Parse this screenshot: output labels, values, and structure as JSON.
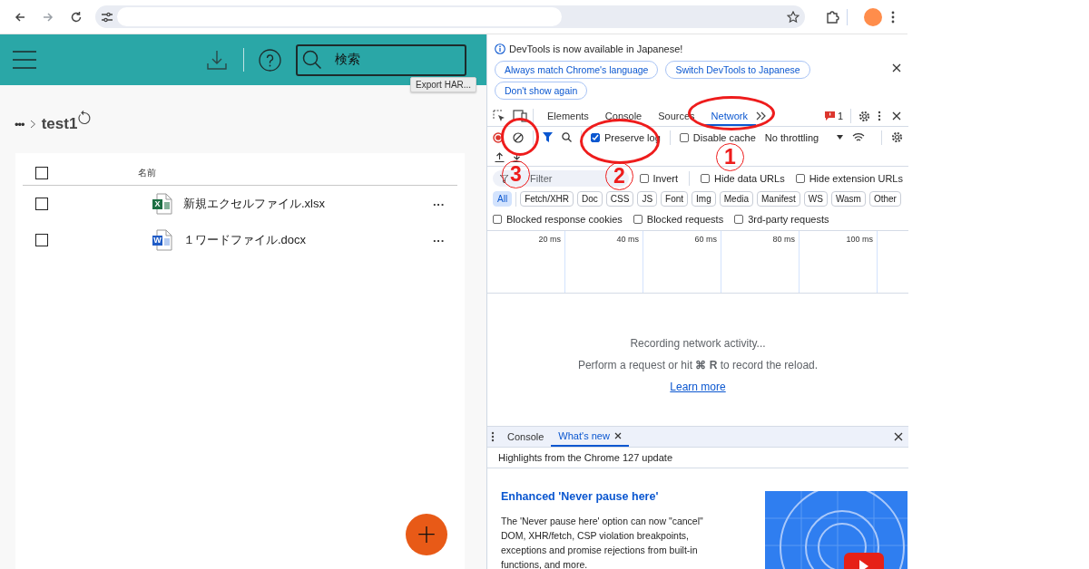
{
  "browser": {
    "nav": [
      {
        "kind": "back",
        "disabled": false
      },
      {
        "kind": "forward",
        "disabled": true
      },
      {
        "kind": "reload",
        "disabled": false
      }
    ]
  },
  "app": {
    "search": {
      "value": "検索"
    },
    "tooltip": "Export HAR...",
    "breadcrumb": {
      "ellipsis": "•••",
      "current": "test1"
    },
    "table": {
      "columns": [
        "名前"
      ],
      "header_checked": false,
      "rows": [
        {
          "kind": "excel",
          "badge": "X",
          "name": "新規エクセルファイル.xlsx",
          "checked": false,
          "menu": "···"
        },
        {
          "kind": "word",
          "badge": "W",
          "name": "１ワードファイル.docx",
          "checked": false,
          "menu": "···"
        }
      ]
    },
    "fab": "+"
  },
  "devtools": {
    "infobar": {
      "message": "DevTools is now available in Japanese!",
      "buttons": [
        "Always match Chrome's language",
        "Switch DevTools to Japanese",
        "Don't show again"
      ]
    },
    "tabs": [
      {
        "label": "Elements",
        "selected": false
      },
      {
        "label": "Console",
        "selected": false
      },
      {
        "label": "Sources",
        "selected": false
      },
      {
        "label": "Network",
        "selected": true
      }
    ],
    "issues_count": "1",
    "toolbar": {
      "preserve_log": {
        "label": "Preserve log",
        "checked": true
      },
      "disable_cache": {
        "label": "Disable cache",
        "checked": false
      },
      "throttling": "No throttling"
    },
    "filter": {
      "placeholder": "Filter",
      "options": [
        {
          "label": "Invert",
          "checked": false
        },
        {
          "label": "Hide data URLs",
          "checked": false
        },
        {
          "label": "Hide extension URLs",
          "checked": false
        }
      ]
    },
    "types": [
      {
        "label": "All",
        "selected": true
      },
      {
        "label": "Fetch/XHR",
        "selected": false
      },
      {
        "label": "Doc",
        "selected": false
      },
      {
        "label": "CSS",
        "selected": false
      },
      {
        "label": "JS",
        "selected": false
      },
      {
        "label": "Font",
        "selected": false
      },
      {
        "label": "Img",
        "selected": false
      },
      {
        "label": "Media",
        "selected": false
      },
      {
        "label": "Manifest",
        "selected": false
      },
      {
        "label": "WS",
        "selected": false
      },
      {
        "label": "Wasm",
        "selected": false
      },
      {
        "label": "Other",
        "selected": false
      }
    ],
    "blocked": [
      {
        "label": "Blocked response cookies",
        "checked": false
      },
      {
        "label": "Blocked requests",
        "checked": false
      },
      {
        "label": "3rd-party requests",
        "checked": false
      }
    ],
    "timeline": {
      "ticks": [
        "20 ms",
        "40 ms",
        "60 ms",
        "80 ms",
        "100 ms"
      ]
    },
    "empty": {
      "title": "Recording network activity...",
      "hint": "Perform a request or hit **⌘ R** to record the reload.",
      "link": "Learn more"
    },
    "drawer": {
      "tabs": [
        {
          "label": "Console",
          "selected": false,
          "closable": false
        },
        {
          "label": "What's new",
          "selected": true,
          "closable": true
        }
      ],
      "subtitle": "Highlights from the Chrome 127 update",
      "article": {
        "title": "Enhanced 'Never pause here'",
        "body": "The 'Never pause here' option can now \"cancel\" DOM, XHR/fetch, CSP violation breakpoints, exceptions and promise rejections from built-in functions, and more."
      }
    }
  },
  "annotations": [
    {
      "label": "1"
    },
    {
      "label": "2"
    },
    {
      "label": "3"
    }
  ]
}
